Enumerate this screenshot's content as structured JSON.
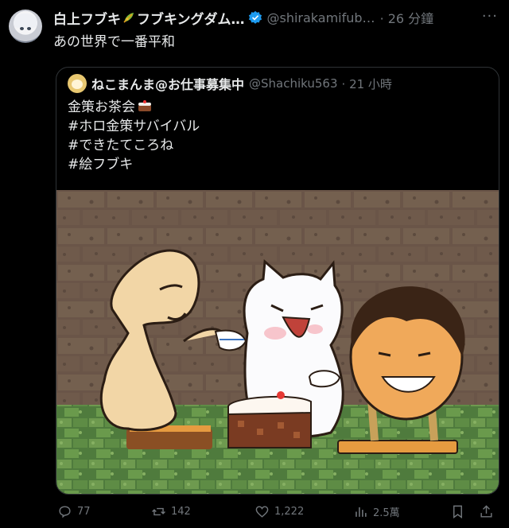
{
  "author": {
    "name_part1": "白上フブキ",
    "name_part2": "フブキングダム…",
    "handle": "@shirakamifub…",
    "time": "· 26 分鐘"
  },
  "tweet_text": "あの世界で一番平和",
  "more_label": "···",
  "quoted": {
    "name": "ねこまんま@お仕事募集中",
    "handle": "@Shachiku563",
    "time": "· 21 小時",
    "lines": [
      "金策お茶会",
      "#ホロ金策サバイバル",
      "#できたてころね",
      "#絵フブキ"
    ]
  },
  "actions": {
    "replies": "77",
    "retweets": "142",
    "likes": "1,222",
    "views": "2.5萬"
  },
  "icons": {
    "verified": "verified-badge-icon",
    "leaf": "leaf-emoji-icon",
    "tea": "tea-cake-emoji-icon",
    "reply": "reply-icon",
    "retweet": "retweet-icon",
    "like": "heart-icon",
    "views": "views-chart-icon",
    "bookmark": "bookmark-icon",
    "share": "share-icon"
  },
  "colors": {
    "background": "#000000",
    "text": "#e7e9ea",
    "muted": "#71767b",
    "verified": "#1d9bf0",
    "border": "#2f3336"
  }
}
